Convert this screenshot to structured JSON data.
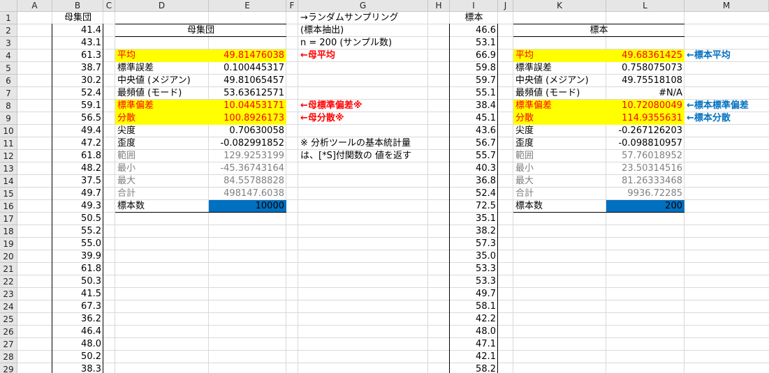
{
  "columns": [
    "A",
    "B",
    "C",
    "D",
    "E",
    "F",
    "G",
    "H",
    "I",
    "J",
    "K",
    "L",
    "M"
  ],
  "rows": [
    1,
    2,
    3,
    4,
    5,
    6,
    7,
    8,
    9,
    10,
    11,
    12,
    13,
    14,
    15,
    16,
    17,
    18,
    19,
    20,
    21,
    22,
    23,
    24,
    25,
    26,
    27,
    28,
    29
  ],
  "colB_header": "母集団",
  "colB_values": [
    "41.4",
    "43.1",
    "61.3",
    "38.7",
    "30.2",
    "52.4",
    "59.1",
    "56.5",
    "49.4",
    "47.2",
    "61.8",
    "48.2",
    "37.5",
    "49.7",
    "49.3",
    "50.5",
    "55.2",
    "55.0",
    "39.9",
    "61.8",
    "50.3",
    "41.5",
    "67.3",
    "36.2",
    "46.4",
    "48.0",
    "50.2",
    "38.3"
  ],
  "colI_header": "標本",
  "colI_values": [
    "46.6",
    "53.1",
    "66.9",
    "59.8",
    "59.7",
    "55.1",
    "38.4",
    "45.1",
    "43.6",
    "56.7",
    "55.7",
    "40.3",
    "36.8",
    "52.4",
    "72.5",
    "35.1",
    "38.2",
    "57.3",
    "35.0",
    "53.3",
    "53.3",
    "49.7",
    "58.1",
    "42.2",
    "48.0",
    "47.1",
    "42.1",
    "58.2"
  ],
  "pop_stats": {
    "title": "母集団",
    "rows": [
      {
        "label": "平均",
        "value": "49.81476038"
      },
      {
        "label": "標準誤差",
        "value": "0.100445317"
      },
      {
        "label": "中央値 (メジアン)",
        "value": "49.81065457"
      },
      {
        "label": "最頻値 (モード)",
        "value": "53.63612571"
      },
      {
        "label": "標準偏差",
        "value": "10.04453171"
      },
      {
        "label": "分散",
        "value": "100.8926173"
      },
      {
        "label": "尖度",
        "value": "0.70630058"
      },
      {
        "label": "歪度",
        "value": "-0.082991852"
      },
      {
        "label": "範囲",
        "value": "129.9253199"
      },
      {
        "label": "最小",
        "value": "-45.36743164"
      },
      {
        "label": "最大",
        "value": "84.55788828"
      },
      {
        "label": "合計",
        "value": "498147.6038"
      },
      {
        "label": "標本数",
        "value": "10000"
      }
    ]
  },
  "sample_stats": {
    "title": "標本",
    "rows": [
      {
        "label": "平均",
        "value": "49.68361425"
      },
      {
        "label": "標準誤差",
        "value": "0.758075073"
      },
      {
        "label": "中央値 (メジアン)",
        "value": "49.75518108"
      },
      {
        "label": "最頻値 (モード)",
        "value": "#N/A"
      },
      {
        "label": "標準偏差",
        "value": "10.72080049"
      },
      {
        "label": "分散",
        "value": "114.9355631"
      },
      {
        "label": "尖度",
        "value": "-0.267126203"
      },
      {
        "label": "歪度",
        "value": "-0.098810957"
      },
      {
        "label": "範囲",
        "value": "57.76018952"
      },
      {
        "label": "最小",
        "value": "23.50314516"
      },
      {
        "label": "最大",
        "value": "81.26333468"
      },
      {
        "label": "合計",
        "value": "9936.72285"
      },
      {
        "label": "標本数",
        "value": "200"
      }
    ]
  },
  "g_notes": {
    "line1": "→ランダムサンプリング",
    "line2": "(標本抽出)",
    "line3": "n = 200 (サンプル数)",
    "arrow_mean": "←母平均",
    "arrow_sd": "←母標準偏差※",
    "arrow_var": "←母分散※",
    "note1": "※ 分析ツールの基本統計量",
    "note2": "は、[*S]付関数の 値を返す"
  },
  "m_notes": {
    "arrow_mean": "←標本平均",
    "arrow_sd": "←標本標準偏差",
    "arrow_var": "←標本分散"
  },
  "colors": {
    "highlight": "#ffff00",
    "count_fill": "#0070c0",
    "red": "#ff0000",
    "blue": "#0070c0",
    "gray": "#808080"
  }
}
